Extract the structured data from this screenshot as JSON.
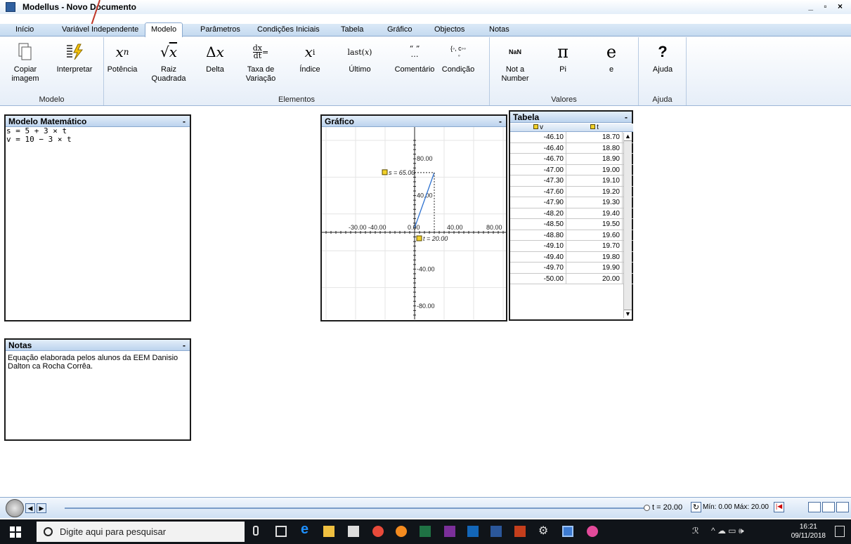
{
  "window": {
    "title": "Modellus - Novo Documento",
    "controls": "_ ▫ ×"
  },
  "menu": {
    "tabs": [
      "Início",
      "Variável Independente",
      "Modelo",
      "Parâmetros",
      "Condições Iniciais",
      "Tabela",
      "Gráfico",
      "Objectos",
      "Notas"
    ],
    "active": "Modelo"
  },
  "ribbon": {
    "groups": [
      {
        "label": "Modelo",
        "buttons": [
          {
            "label": "Copiar imagem",
            "icon": "copy-image-icon"
          },
          {
            "label": "Interpretar",
            "icon": "interpret-icon"
          }
        ]
      },
      {
        "label": "Elementos",
        "buttons": [
          {
            "label": "Potência",
            "glyph": "xⁿ"
          },
          {
            "label": "Raiz Quadrada",
            "glyph": "√x"
          },
          {
            "label": "Delta",
            "glyph": "Δx"
          },
          {
            "label": "Taxa de Variação",
            "glyph": "dx/dt ="
          },
          {
            "label": "Índice",
            "glyph": "xᵢ"
          },
          {
            "label": "Último",
            "glyph": "last(x)"
          },
          {
            "label": "Comentário",
            "glyph": "\" \" …"
          },
          {
            "label": "Condição",
            "glyph": "{ ◦, c◦◦"
          }
        ]
      },
      {
        "label": "Valores",
        "buttons": [
          {
            "label": "Not a Number",
            "glyph": "NaN"
          },
          {
            "label": "Pi",
            "glyph": "π"
          },
          {
            "label": "e",
            "glyph": "e"
          }
        ]
      },
      {
        "label": "Ajuda",
        "buttons": [
          {
            "label": "Ajuda",
            "glyph": "?"
          }
        ]
      }
    ]
  },
  "model_panel": {
    "title": "Modelo Matemático",
    "min": "-",
    "equations": [
      "s = 5 + 3 × t",
      "v = 10 − 3 × t"
    ]
  },
  "notes_panel": {
    "title": "Notas",
    "min": "-",
    "text": "Equação elaborada pelos alunos da EEM Danisio Dalton ca Rocha Corrêa."
  },
  "graph_panel": {
    "title": "Gráfico",
    "min": "-",
    "x_ticks": [
      "-30.00",
      "-40.00",
      "0.00",
      "40.00",
      "80.00"
    ],
    "y_ticks": [
      "80.00",
      "40.00",
      "-40.00",
      "-80.00"
    ],
    "markers": {
      "s": "s = 65.00",
      "t": "t = 20.00"
    }
  },
  "chart_data": {
    "type": "line",
    "series": [
      {
        "name": "s",
        "x": [
          0,
          20
        ],
        "y": [
          5,
          65
        ]
      }
    ],
    "x_range": [
      -90,
      90
    ],
    "y_range": [
      -100,
      100
    ],
    "grid": true,
    "annotations": [
      "s = 65.00",
      "t = 20.00"
    ]
  },
  "table_panel": {
    "title": "Tabela",
    "min": "-",
    "columns": [
      "v",
      "t"
    ],
    "rows": [
      [
        "-46.10",
        "18.70"
      ],
      [
        "-46.40",
        "18.80"
      ],
      [
        "-46.70",
        "18.90"
      ],
      [
        "-47.00",
        "19.00"
      ],
      [
        "-47.30",
        "19.10"
      ],
      [
        "-47.60",
        "19.20"
      ],
      [
        "-47.90",
        "19.30"
      ],
      [
        "-48.20",
        "19.40"
      ],
      [
        "-48.50",
        "19.50"
      ],
      [
        "-48.80",
        "19.60"
      ],
      [
        "-49.10",
        "19.70"
      ],
      [
        "-49.40",
        "19.80"
      ],
      [
        "-49.70",
        "19.90"
      ],
      [
        "-50.00",
        "20.00"
      ]
    ]
  },
  "control_bar": {
    "t_value": "t = 20.00",
    "minmax": "Mín: 0.00 Máx: 20.00"
  },
  "taskbar": {
    "search_placeholder": "Digite aqui para pesquisar",
    "time": "16:21",
    "date": "09/11/2018"
  }
}
